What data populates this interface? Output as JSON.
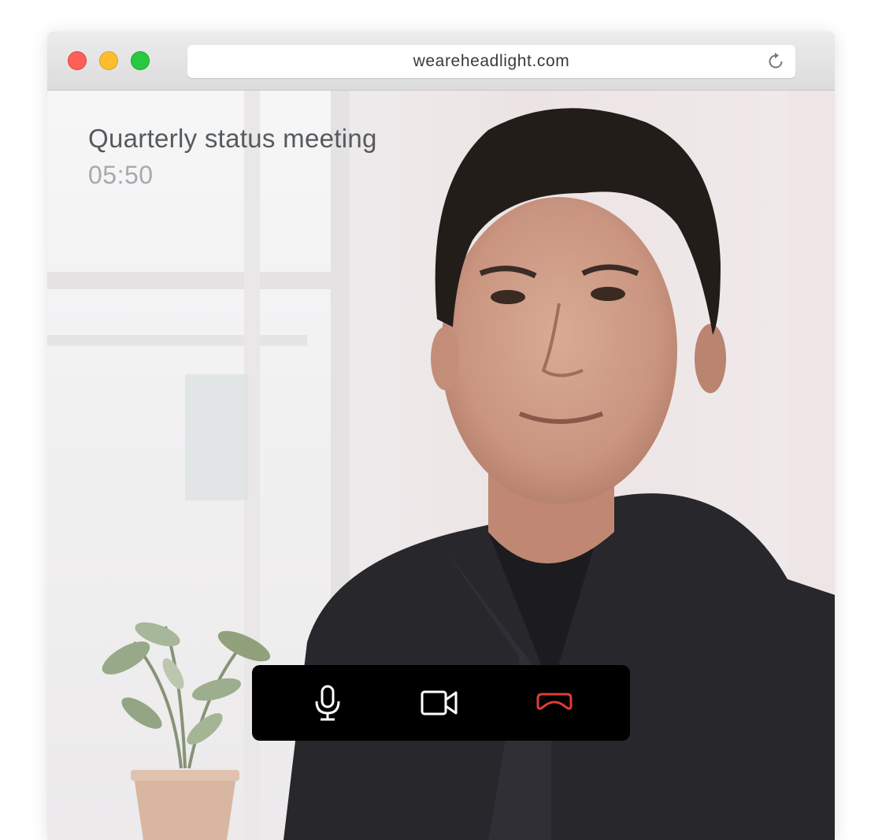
{
  "browser": {
    "url": "weareheadlight.com"
  },
  "call": {
    "title": "Quarterly status meeting",
    "timer": "05:50"
  },
  "controls": {
    "mic_icon": "microphone-icon",
    "camera_icon": "video-camera-icon",
    "hangup_icon": "hang-up-icon",
    "hangup_color": "#e03b3b",
    "icon_color": "#ffffff"
  }
}
